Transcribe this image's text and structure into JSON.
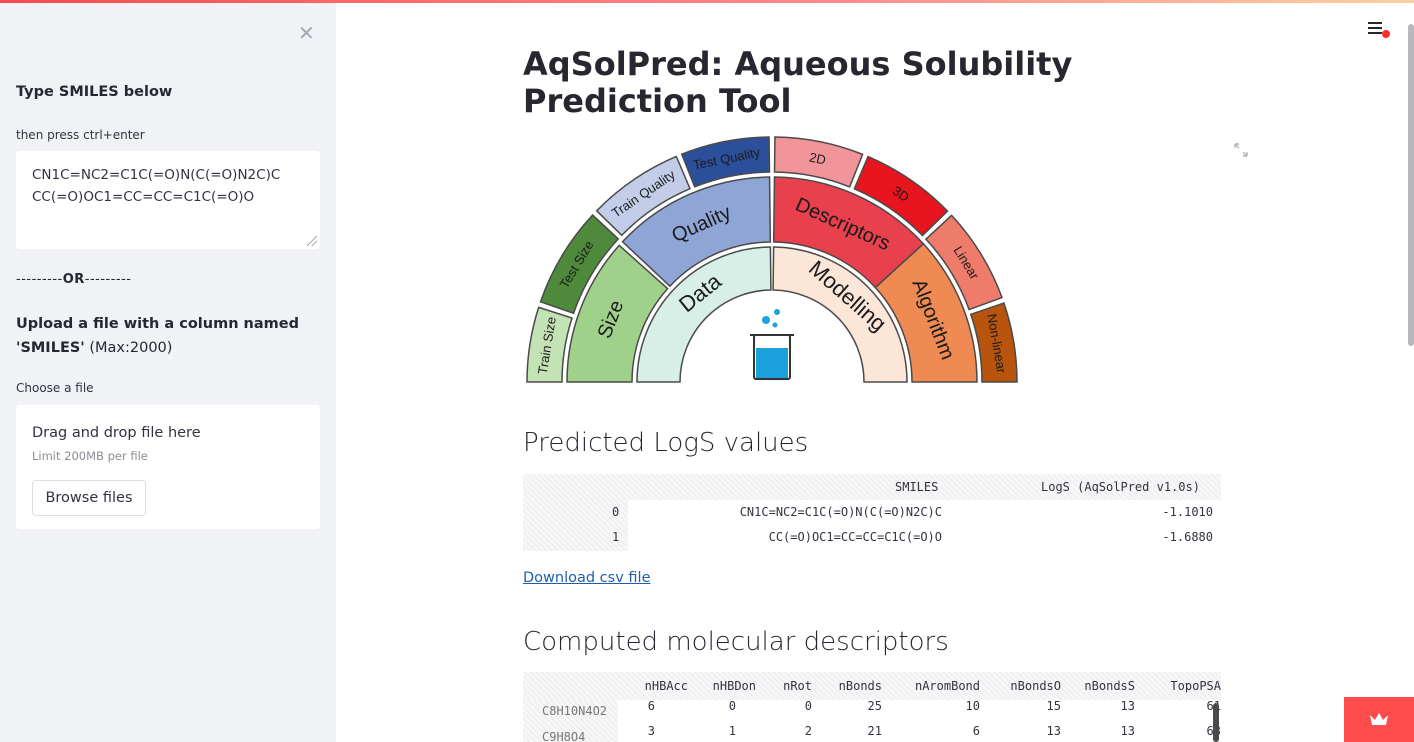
{
  "sidebar": {
    "close_glyph": "✕",
    "heading": "Type SMILES below",
    "hint": "then press ctrl+enter",
    "smiles_lines": [
      "CN1C=NC2=C1C(=O)N(C(=O)N2C)C",
      "CC(=O)OC1=CC=CC=C1C(=O)O"
    ],
    "or_left": "---------",
    "or_text": "OR",
    "or_right": "---------",
    "upload_bold": "Upload a file with a column named 'SMILES'",
    "upload_rest": " (Max:2000)",
    "choose_label": "Choose a file",
    "dropzone_title": "Drag and drop file here",
    "dropzone_limit": "Limit 200MB per file",
    "browse_label": "Browse files"
  },
  "main": {
    "title": "AqSolPred: Aqueous Solubility Prediction Tool",
    "figure": {
      "inner": [
        "Data",
        "Modelling"
      ],
      "middle": [
        "Size",
        "Quality",
        "Descriptors",
        "Algorithm"
      ],
      "outer": [
        "Train Size",
        "Test Size",
        "Train Quality",
        "Test Quality",
        "2D",
        "3D",
        "Linear",
        "Non-linear"
      ],
      "colors": {
        "data": "#d8efe8",
        "modelling": "#fbe6d8",
        "size": "#9fd18a",
        "quality": "#8ea5d6",
        "descriptors": "#e8404d",
        "algorithm": "#ee8a52",
        "train_size": "#c4e3b4",
        "test_size": "#4f8a3c",
        "train_quality": "#c3cde8",
        "test_quality": "#2c4f9c",
        "2d": "#f2959a",
        "3d": "#e8141e",
        "linear": "#ef7b6b",
        "non_linear": "#b8540e"
      }
    },
    "predicted_heading": "Predicted LogS values",
    "pred_table": {
      "columns": [
        "SMILES",
        "LogS (AqSolPred v1.0s)"
      ],
      "rows": [
        {
          "index": "0",
          "smiles": "CN1C=NC2=C1C(=O)N(C(=O)N2C)C",
          "logs": "-1.1010"
        },
        {
          "index": "1",
          "smiles": "CC(=O)OC1=CC=CC=C1C(=O)O",
          "logs": "-1.6880"
        }
      ]
    },
    "download_label": "Download csv file",
    "descriptors_heading": "Computed molecular descriptors",
    "desc_table": {
      "columns": [
        "nHBAcc",
        "nHBDon",
        "nRot",
        "nBonds",
        "nAromBond",
        "nBondsO",
        "nBondsS",
        "TopoPSA"
      ],
      "rows": [
        {
          "index": "C8H10N4O2",
          "values": [
            "6",
            "0",
            "0",
            "25",
            "10",
            "15",
            "13",
            "61"
          ]
        },
        {
          "index": "C9H8O4",
          "values": [
            "3",
            "1",
            "2",
            "21",
            "6",
            "13",
            "13",
            "63"
          ]
        }
      ]
    }
  },
  "icons": [
    "close-icon",
    "hamburger-menu-icon",
    "fullscreen-icon",
    "streamlit-logo-icon"
  ]
}
